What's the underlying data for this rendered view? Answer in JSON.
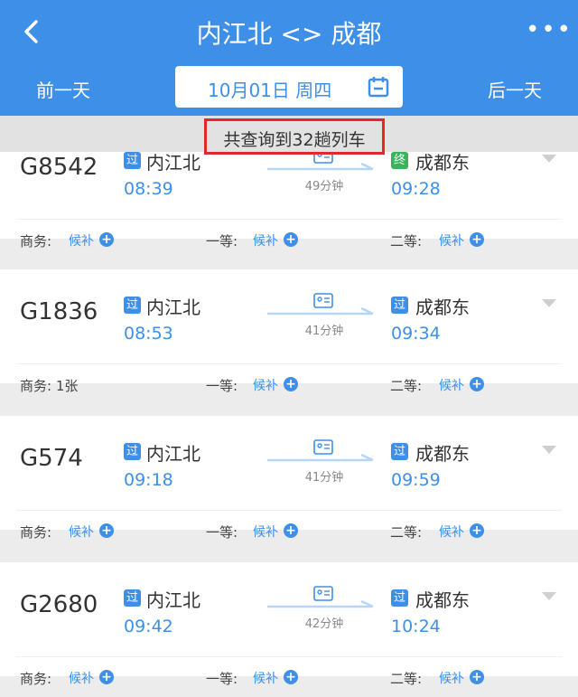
{
  "header": {
    "title": "内江北 <> 成都",
    "more": "•••",
    "prev_day": "前一天",
    "next_day": "后一天",
    "date": "10月01日 周四"
  },
  "summary": {
    "text": "共查询到32趟列车"
  },
  "trains": [
    {
      "number": "G8542",
      "from_badge": "过",
      "from": "内江北",
      "depart": "08:39",
      "duration": "49分钟",
      "to_badge": "终",
      "to": "成都东",
      "arrive": "09:28",
      "seats": [
        {
          "label": "商务:",
          "value": "候补"
        },
        {
          "label": "一等:",
          "value": "候补"
        },
        {
          "label": "二等:",
          "value": "候补"
        }
      ]
    },
    {
      "number": "G1836",
      "from_badge": "过",
      "from": "内江北",
      "depart": "08:53",
      "duration": "41分钟",
      "to_badge": "过",
      "to": "成都东",
      "arrive": "09:34",
      "seats": [
        {
          "label": "商务: 1张",
          "value": ""
        },
        {
          "label": "一等:",
          "value": "候补"
        },
        {
          "label": "二等:",
          "value": "候补"
        }
      ]
    },
    {
      "number": "G574",
      "from_badge": "过",
      "from": "内江北",
      "depart": "09:18",
      "duration": "41分钟",
      "to_badge": "过",
      "to": "成都东",
      "arrive": "09:59",
      "seats": [
        {
          "label": "商务:",
          "value": "候补"
        },
        {
          "label": "一等:",
          "value": "候补"
        },
        {
          "label": "二等:",
          "value": "候补"
        }
      ]
    },
    {
      "number": "G2680",
      "from_badge": "过",
      "from": "内江北",
      "depart": "09:42",
      "duration": "42分钟",
      "to_badge": "过",
      "to": "成都东",
      "arrive": "10:24",
      "seats": [
        {
          "label": "商务:",
          "value": "候补"
        },
        {
          "label": "一等:",
          "value": "候补"
        },
        {
          "label": "二等:",
          "value": "候补"
        }
      ]
    }
  ],
  "colors": {
    "accent": "#3d8fe8",
    "highlight": "#e3272b",
    "terminal_badge": "#3cb25b"
  }
}
